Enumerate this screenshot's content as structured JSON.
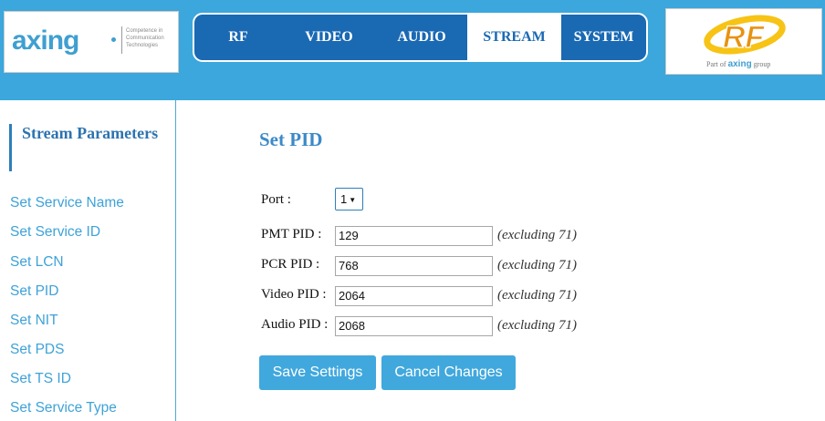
{
  "header": {
    "logo_axing": {
      "word": "axing",
      "tagline": "Competence in Communication Technologies"
    },
    "nav_tabs": [
      {
        "label": "RF",
        "active": false
      },
      {
        "label": "VIDEO",
        "active": false
      },
      {
        "label": "AUDIO",
        "active": false
      },
      {
        "label": "STREAM",
        "active": true
      },
      {
        "label": "SYSTEM",
        "active": false
      }
    ],
    "logo_rf": {
      "mark": "RF",
      "subtitle_prefix": "Part of",
      "subtitle_brand": "axing",
      "subtitle_suffix": "group"
    }
  },
  "sidebar": {
    "title": "Stream Parameters",
    "items": [
      {
        "label": "Set Service Name"
      },
      {
        "label": "Set Service ID"
      },
      {
        "label": "Set LCN"
      },
      {
        "label": "Set PID"
      },
      {
        "label": "Set NIT"
      },
      {
        "label": "Set PDS"
      },
      {
        "label": "Set TS ID"
      },
      {
        "label": "Set Service Type"
      }
    ]
  },
  "main": {
    "title": "Set PID",
    "port": {
      "label": "Port :",
      "value": "1"
    },
    "fields": [
      {
        "label": "PMT PID :",
        "value": "129",
        "hint": "(excluding 71)"
      },
      {
        "label": "PCR PID :",
        "value": "768",
        "hint": "(excluding 71)"
      },
      {
        "label": "Video PID :",
        "value": "2064",
        "hint": "(excluding 71)"
      },
      {
        "label": "Audio PID :",
        "value": "2068",
        "hint": "(excluding 71)"
      }
    ],
    "buttons": {
      "save": "Save Settings",
      "cancel": "Cancel Changes"
    }
  },
  "colors": {
    "header_bg": "#3ba7dc",
    "nav_bg": "#1a69b3",
    "button_bg": "#40a8dd",
    "link": "#3ea2d8",
    "title": "#3b8ac8",
    "rf_yellow": "#f7c315",
    "rf_orange": "#e8920f"
  }
}
